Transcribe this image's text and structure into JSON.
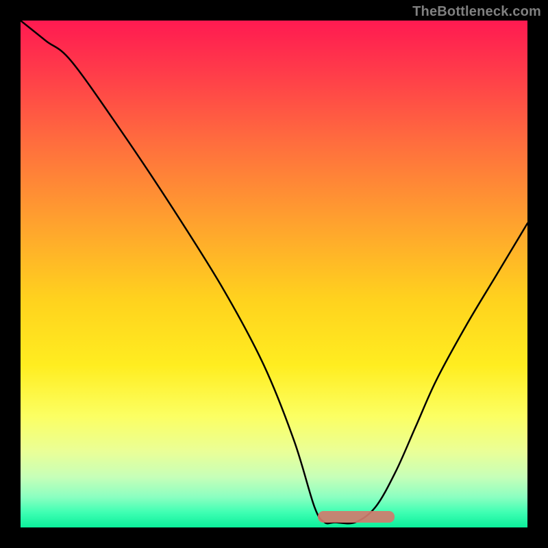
{
  "watermark": "TheBottleneck.com",
  "chart_data": {
    "type": "line",
    "title": "",
    "xlabel": "",
    "ylabel": "",
    "x_range": [
      0,
      100
    ],
    "y_range": [
      0,
      100
    ],
    "series": [
      {
        "name": "curve",
        "x": [
          0,
          5,
          10,
          20,
          30,
          40,
          48,
          54,
          58,
          60,
          62,
          66,
          70,
          74,
          78,
          82,
          88,
          94,
          100
        ],
        "y": [
          100,
          96,
          92,
          78,
          63,
          47,
          32,
          17,
          4,
          1,
          1,
          1,
          4,
          11,
          20,
          29,
          40,
          50,
          60
        ]
      }
    ],
    "highlight_band": {
      "x_start": 59,
      "x_end": 74,
      "y": 1
    },
    "background_gradient": {
      "direction": "vertical",
      "stops": [
        {
          "offset": 0.0,
          "color": "#ff1a51"
        },
        {
          "offset": 0.24,
          "color": "#ff6d3e"
        },
        {
          "offset": 0.55,
          "color": "#ffd21e"
        },
        {
          "offset": 0.78,
          "color": "#fcff62"
        },
        {
          "offset": 0.94,
          "color": "#8bffc1"
        },
        {
          "offset": 1.0,
          "color": "#0bef9b"
        }
      ]
    }
  }
}
